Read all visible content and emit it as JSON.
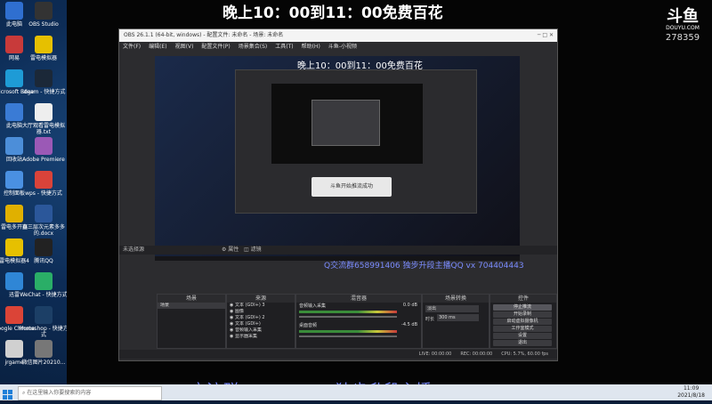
{
  "stream": {
    "title_overlay": "晚上10：00到11：00免费百花",
    "bottom_banner": "Q交流群658991406 独步升段主播QQ vx 704404443",
    "platform_logo": "斗鱼",
    "platform_domain": "DOUYU.COM",
    "room_number": "278359"
  },
  "desktop_icons": [
    {
      "label": "此电脑",
      "color": "#2f6fd0"
    },
    {
      "label": "OBS Studio",
      "color": "#333"
    },
    {
      "label": "网易",
      "color": "#c83a3a"
    },
    {
      "label": "雷电模拟器",
      "color": "#e6c000"
    },
    {
      "label": "Microsoft Edge",
      "color": "#1e9bd6"
    },
    {
      "label": "steam - 快捷方式",
      "color": "#1b2838"
    },
    {
      "label": "此电脑",
      "color": "#3a7bd5"
    },
    {
      "label": "大厅观看雷电模拟器.txt",
      "color": "#eee"
    },
    {
      "label": "回收站",
      "color": "#4c8ed9"
    },
    {
      "label": "Adobe Premiere",
      "color": "#9b59b6"
    },
    {
      "label": "控制面板",
      "color": "#4a90e2"
    },
    {
      "label": "wps - 快捷方式",
      "color": "#d9433a"
    },
    {
      "label": "雷电多开器",
      "color": "#e0b000"
    },
    {
      "label": "直三层次元素多多的.docx",
      "color": "#2b579a"
    },
    {
      "label": "雷电模拟器4",
      "color": "#e6c000"
    },
    {
      "label": "腾讯QQ",
      "color": "#222"
    },
    {
      "label": "迅雷",
      "color": "#2f86d6"
    },
    {
      "label": "WeChat - 快捷方式",
      "color": "#2aae67"
    },
    {
      "label": "Google Chrome",
      "color": "#db4437"
    },
    {
      "label": "Photoshop - 快捷方式",
      "color": "#1c3f66"
    },
    {
      "label": "jrgame",
      "color": "#d0d0d0"
    },
    {
      "label": "微信图片20210...",
      "color": "#777"
    }
  ],
  "obs": {
    "title": "OBS 26.1.1 (64-bit, windows) - 配置文件: 未命名 - 场景: 未命名",
    "menu": [
      "文件(F)",
      "编辑(E)",
      "视图(V)",
      "配置文件(P)",
      "场景集合(S)",
      "工具(T)",
      "帮助(H)",
      "斗鱼-小视频"
    ],
    "preview_mini_overlay": "晚上10：00到11：00免费百花",
    "preview_banner": "Q交流群658991406 独步升段主播QQ vx 704404443",
    "popup_text": "斗鱼开始推流成功",
    "status_bar": "未选择源",
    "properties_btn": "属性",
    "filters_btn": "滤镜",
    "scenes_header": "场景",
    "scenes": [
      "场景"
    ],
    "sources_header": "来源",
    "sources": [
      "文本 (GDI+) 3",
      "图像",
      "文本 (GDI+) 2",
      "文本 (GDI+)",
      "音频输入采集",
      "显示器采集"
    ],
    "mixer_header": "混音器",
    "mixer": [
      {
        "name": "音频输入采集",
        "db": "0.0 dB"
      },
      {
        "name": "桌面音频",
        "db": "-4.5 dB"
      }
    ],
    "transitions_header": "场景转换",
    "transition_type": "淡出",
    "duration_label": "时长",
    "duration_value": "300 ms",
    "controls_header": "控件",
    "controls": [
      "停止推流",
      "开始录制",
      "启动虚拟摄像机",
      "工作室模式",
      "设置",
      "退出"
    ],
    "status_items": [
      "LIVE: 00:00:00",
      "REC: 00:00:00",
      "CPU: 5.7%, 60.00 fps"
    ]
  },
  "taskbar": {
    "search_placeholder": "在这里输入你要搜索的内容",
    "time": "11:09",
    "date": "2021/8/18"
  }
}
